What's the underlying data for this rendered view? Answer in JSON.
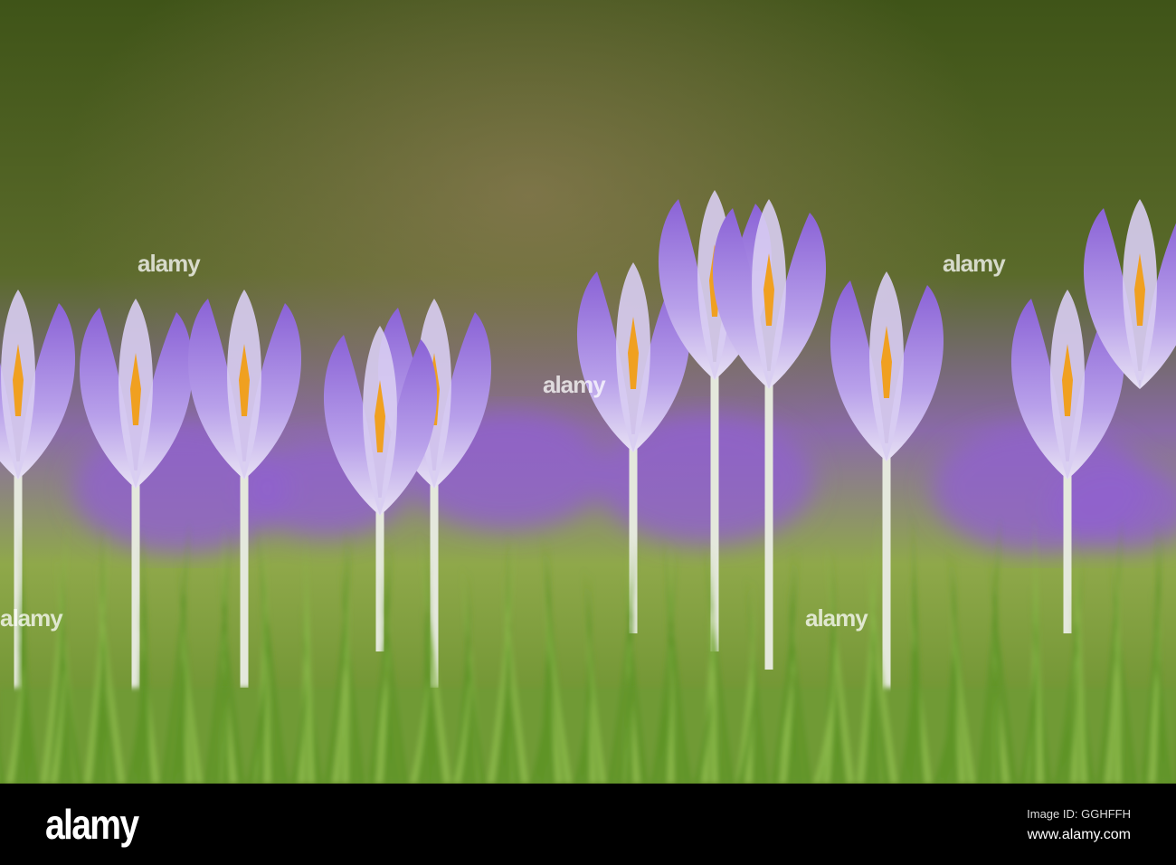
{
  "photo": {
    "subject": "purple crocus flowers in grass",
    "colors": {
      "background": "#4a5a1e",
      "petal": "#9a70d8",
      "petal_light": "#d8cdf2",
      "stamen": "#f0a020",
      "grass": "#6a9a30"
    }
  },
  "watermark": {
    "text": "alamy"
  },
  "footer": {
    "logo": "alamy",
    "image_id": "Image ID: GGHFFH",
    "website": "www.alamy.com"
  }
}
